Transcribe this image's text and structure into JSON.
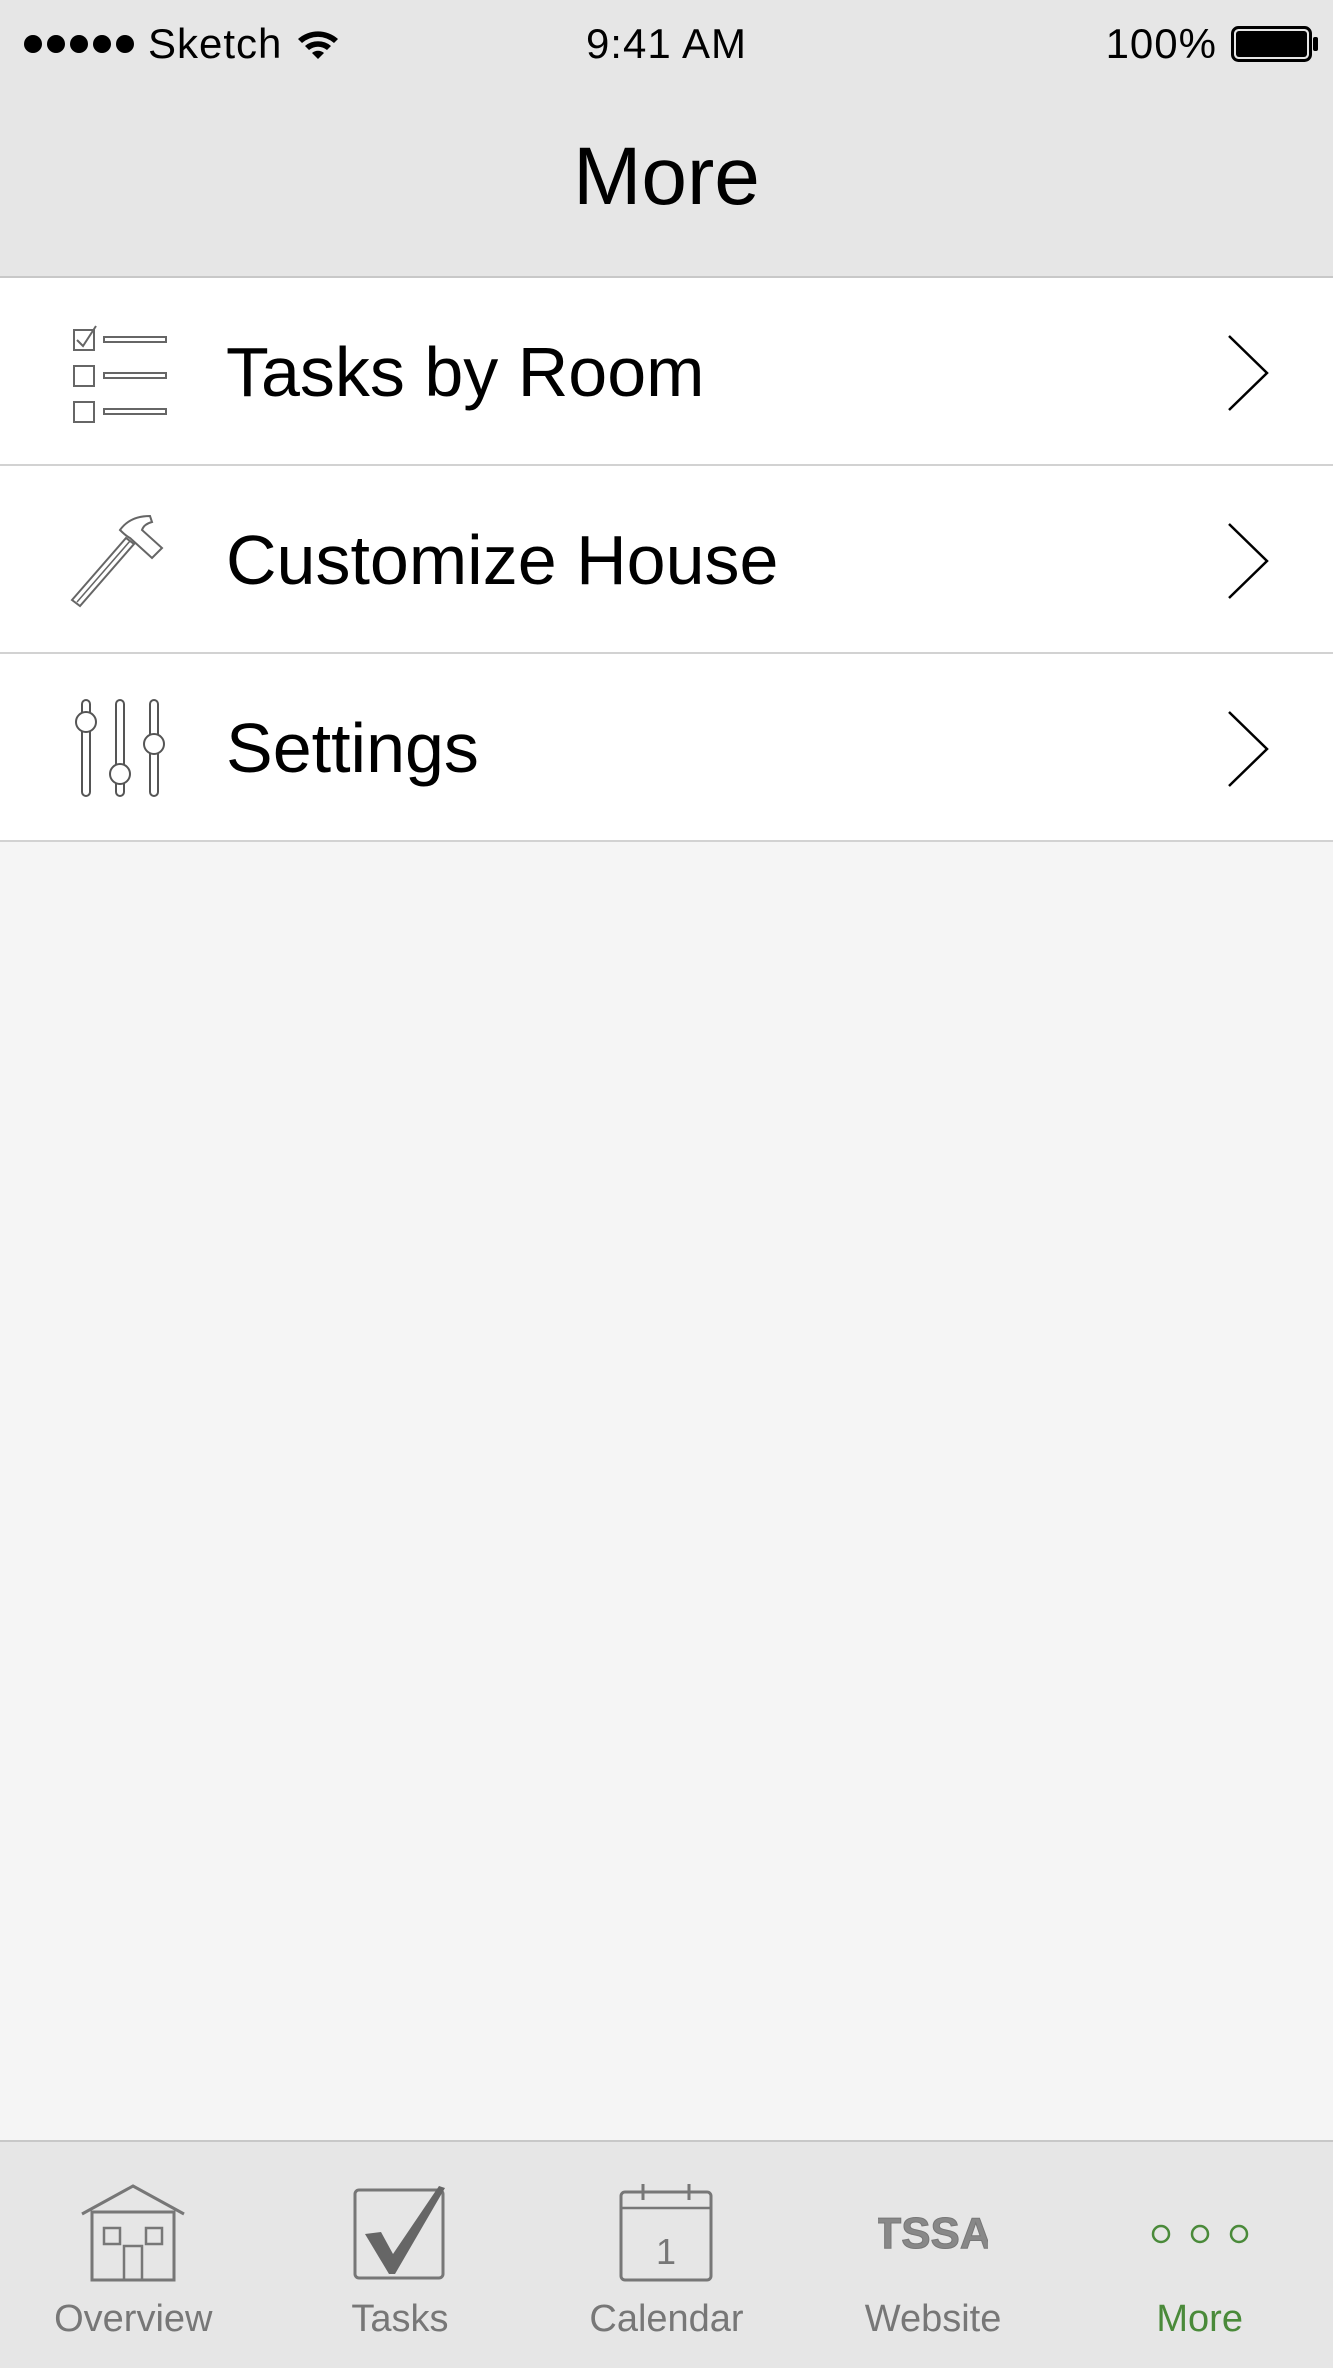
{
  "status_bar": {
    "carrier": "Sketch",
    "time": "9:41 AM",
    "battery": "100%"
  },
  "nav": {
    "title": "More"
  },
  "menu": {
    "items": [
      {
        "label": "Tasks by Room",
        "icon": "checklist-icon"
      },
      {
        "label": "Customize House",
        "icon": "hammer-icon"
      },
      {
        "label": "Settings",
        "icon": "sliders-icon"
      }
    ]
  },
  "tab_bar": {
    "tabs": [
      {
        "label": "Overview",
        "icon": "house-icon"
      },
      {
        "label": "Tasks",
        "icon": "checkbox-icon"
      },
      {
        "label": "Calendar",
        "icon": "calendar-icon",
        "icon_text": "1"
      },
      {
        "label": "Website",
        "icon": "tssa-logo-icon",
        "icon_text": "TSSA"
      },
      {
        "label": "More",
        "icon": "more-dots-icon",
        "active": true
      }
    ],
    "active_color": "#4a8a3a",
    "inactive_color": "#777777"
  }
}
